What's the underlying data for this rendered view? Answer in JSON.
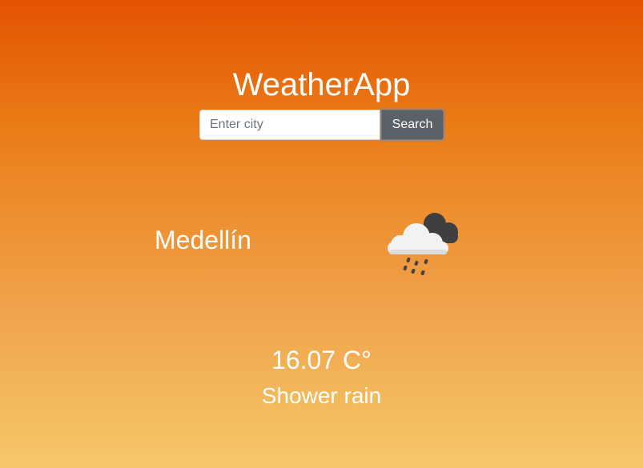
{
  "app": {
    "title": "WeatherApp"
  },
  "search": {
    "placeholder": "Enter city",
    "value": "",
    "button_label": "Search"
  },
  "weather": {
    "city": "Medellín",
    "temperature": "16.07 C°",
    "description": "Shower rain",
    "icon": "shower-rain-cloud-icon"
  },
  "colors": {
    "gradient_top": "#e35300",
    "gradient_bottom": "#f6c86a",
    "button_bg": "#5a6268",
    "text": "#ffffff"
  }
}
